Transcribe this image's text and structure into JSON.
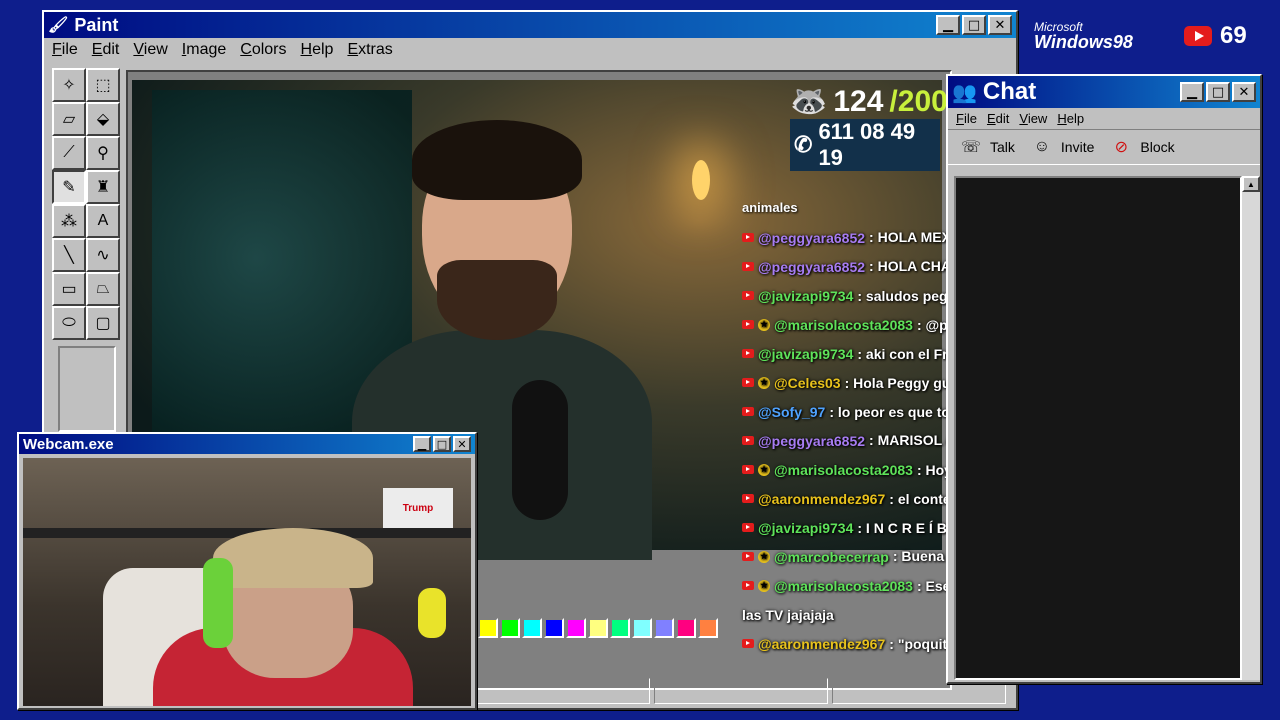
{
  "colors": {
    "desktop": "#0e1e8c",
    "titlebar_start": "#000b82",
    "titlebar_end": "#1084d0",
    "goal_accent": "#c8f03c"
  },
  "desktop": {
    "brand_small": "Microsoft",
    "brand_big": "Windows98",
    "youtube_count": "69"
  },
  "paint": {
    "title": "Paint",
    "menu": [
      "File",
      "Edit",
      "View",
      "Image",
      "Colors",
      "Help",
      "Extras"
    ],
    "tools": [
      {
        "name": "free-select-icon",
        "glyph": "✧"
      },
      {
        "name": "rect-select-icon",
        "glyph": "⬚"
      },
      {
        "name": "eraser-icon",
        "glyph": "▱"
      },
      {
        "name": "fill-bucket-icon",
        "glyph": "⬙"
      },
      {
        "name": "color-picker-icon",
        "glyph": "⟋"
      },
      {
        "name": "magnifier-icon",
        "glyph": "⚲"
      },
      {
        "name": "pencil-icon",
        "glyph": "✎"
      },
      {
        "name": "brush-icon",
        "glyph": "♜"
      },
      {
        "name": "airbrush-icon",
        "glyph": "⁂"
      },
      {
        "name": "text-icon",
        "glyph": "A"
      },
      {
        "name": "line-icon",
        "glyph": "╲"
      },
      {
        "name": "curve-icon",
        "glyph": "∿"
      },
      {
        "name": "rectangle-icon",
        "glyph": "▭"
      },
      {
        "name": "polygon-icon",
        "glyph": "⏢"
      },
      {
        "name": "ellipse-icon",
        "glyph": "⬭"
      },
      {
        "name": "rounded-rect-icon",
        "glyph": "▢"
      }
    ],
    "palette": [
      "#ffff00",
      "#00ff00",
      "#00ffff",
      "#0000ff",
      "#ff00ff",
      "#ffff80",
      "#00ff80",
      "#80ffff",
      "#8080ff",
      "#ff0080",
      "#ff8040"
    ]
  },
  "stream": {
    "goal_current": "124",
    "goal_target": "/200",
    "phone": "611 08 49 19"
  },
  "webcam": {
    "title": "Webcam.exe",
    "box_label": "Trump"
  },
  "chat_overlay": {
    "header": "animales",
    "messages": [
      {
        "user": "@peggyara6852",
        "text": " : HOLA MEXI BUENAS NOCHES SALUDOS 💜 💜 💜 💜",
        "color": "#a77cf2",
        "badge": false
      },
      {
        "user": "@peggyara6852",
        "text": " : HOLA CHAT SALUDOS 💜 💜 💜 💜",
        "color": "#a77cf2",
        "badge": false
      },
      {
        "user": "@javizapi9734",
        "text": " : saludos peggy",
        "color": "#5fe35a",
        "badge": false
      },
      {
        "user": "@marisolacosta2083",
        "text": " : @peggy saludos",
        "color": "#5fe35a",
        "badge": true
      },
      {
        "user": "@javizapi9734",
        "text": " : aki con el Frank de nuevo jajaja",
        "color": "#5fe35a",
        "badge": false
      },
      {
        "user": "@Celes03",
        "text": " : Hola Peggy guapa",
        "color": "#e8c21c",
        "badge": true
      },
      {
        "user": "@Sofy_97",
        "text": " : lo peor es que todo lo que le donan se lo gastan los hijos en l",
        "color": "#4fa3ff",
        "badge": false
      },
      {
        "user": "@peggyara6852",
        "text": " : MARISOL & CELES BESOS 🥰 😘",
        "color": "#a77cf2",
        "badge": false
      },
      {
        "user": "@marisolacosta2083",
        "text": " : Hoy no llora... y en días para el trullo jajajaja",
        "color": "#5fe35a",
        "badge": true
      },
      {
        "user": "@aaronmendez967",
        "text": " : el contenido que se merecen esos",
        "color": "#e8c21c",
        "badge": false
      },
      {
        "user": "@javizapi9734",
        "text": " : I N C R E Í B L E",
        "color": "#5fe35a",
        "badge": false
      },
      {
        "user": "@marcobecerrap",
        "text": " : Buena tarde tais! 😎 😎 😎",
        "color": "#5fe35a",
        "badge": true
      },
      {
        "user": "@marisolacosta2083",
        "text": " : Ese anuncio es una serie que él ha echo y lo va",
        "color": "#5fe35a",
        "badge": true
      },
      {
        "user": "",
        "text": "las TV jajajaja",
        "color": "#ffffff",
        "badge": false
      },
      {
        "user": "@aaronmendez967",
        "text": " : \"poquito más \" eso fue lo más relevante entonces n",
        "color": "#e8c21c",
        "badge": false
      }
    ]
  },
  "chat_window": {
    "title": "Chat",
    "menu": [
      "File",
      "Edit",
      "View",
      "Help"
    ],
    "toolbar": [
      {
        "name": "talk-button",
        "icon": "talk-icon",
        "glyph": "☏",
        "label": "Talk"
      },
      {
        "name": "invite-button",
        "icon": "invite-icon",
        "glyph": "☺",
        "label": "Invite"
      },
      {
        "name": "block-button",
        "icon": "block-icon",
        "glyph": "⊘",
        "label": "Block"
      }
    ]
  }
}
